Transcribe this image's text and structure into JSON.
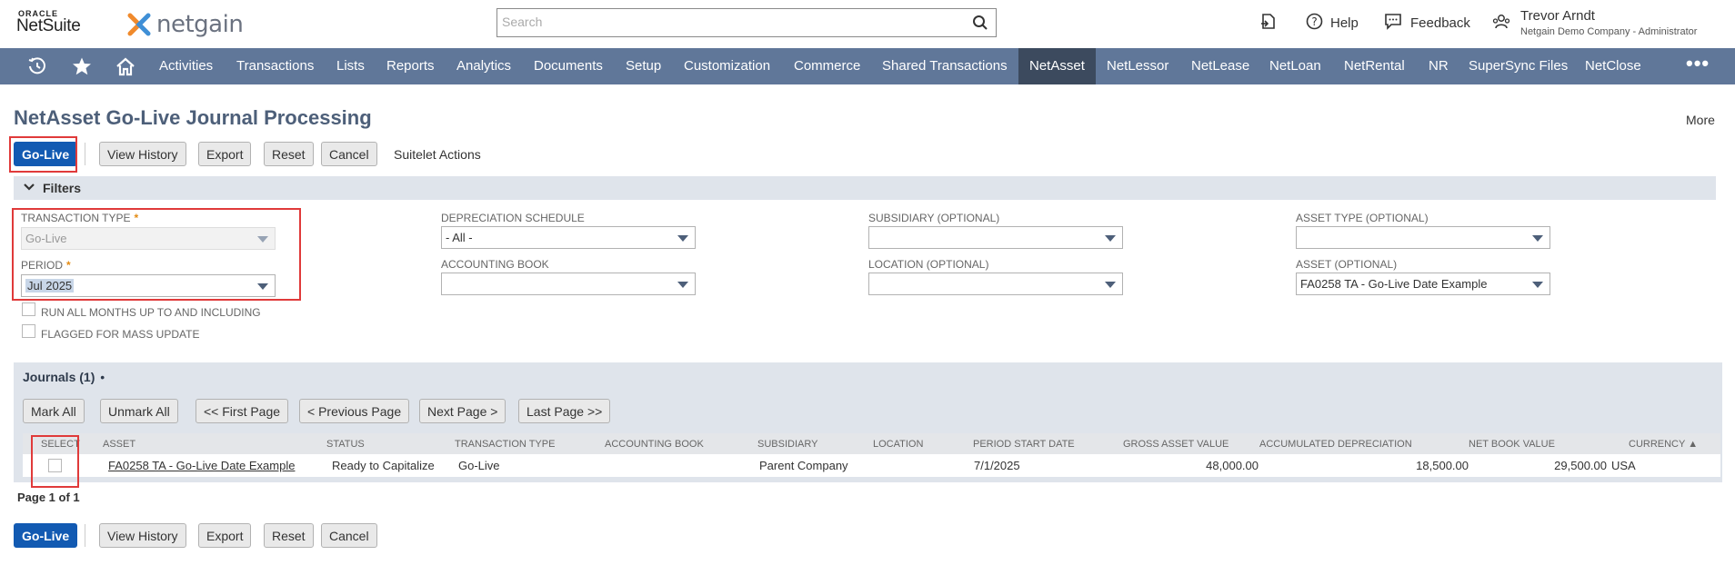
{
  "header": {
    "oracle_label": "ORACLE",
    "netsuite_label": "NetSuite",
    "netgain_label": "netgain",
    "search_placeholder": "Search",
    "help_label": "Help",
    "feedback_label": "Feedback",
    "user_name": "Trevor Arndt",
    "user_role": "Netgain Demo Company - Administrator"
  },
  "nav": {
    "items": [
      "Activities",
      "Transactions",
      "Lists",
      "Reports",
      "Analytics",
      "Documents",
      "Setup",
      "Customization",
      "Commerce",
      "Shared Transactions",
      "NetAsset",
      "NetLessor",
      "NetLease",
      "NetLoan",
      "NetRental",
      "NR",
      "SuperSync Files",
      "NetClose"
    ],
    "active": "NetAsset",
    "more": "•••"
  },
  "page": {
    "title": "NetAsset Go-Live Journal Processing",
    "more_label": "More"
  },
  "actions": {
    "go_live": "Go-Live",
    "view_history": "View History",
    "export": "Export",
    "reset": "Reset",
    "cancel": "Cancel",
    "suitelet_actions": "Suitelet Actions"
  },
  "filters": {
    "section_label": "Filters",
    "transaction_type": {
      "label": "TRANSACTION TYPE",
      "value": "Go-Live"
    },
    "period": {
      "label": "PERIOD",
      "value": "Jul 2025"
    },
    "run_all_months": "RUN ALL MONTHS UP TO AND INCLUDING",
    "flagged_mass_update": "FLAGGED FOR MASS UPDATE",
    "depreciation_schedule": {
      "label": "DEPRECIATION SCHEDULE",
      "value": "- All -"
    },
    "accounting_book": {
      "label": "ACCOUNTING BOOK",
      "value": ""
    },
    "subsidiary": {
      "label": "SUBSIDIARY (OPTIONAL)",
      "value": ""
    },
    "location": {
      "label": "LOCATION (OPTIONAL)",
      "value": ""
    },
    "asset_type": {
      "label": "ASSET TYPE (OPTIONAL)",
      "value": ""
    },
    "asset": {
      "label": "ASSET (OPTIONAL)",
      "value": "FA0258 TA - Go-Live Date Example"
    }
  },
  "journals": {
    "tab_label": "Journals (1)",
    "tab_dot": "•",
    "buttons": {
      "mark_all": "Mark All",
      "unmark_all": "Unmark All",
      "first_page": "<< First Page",
      "previous_page": "< Previous Page",
      "next_page": "Next Page >",
      "last_page": "Last Page >>"
    },
    "columns": {
      "select": "SELECT",
      "asset": "ASSET",
      "status": "STATUS",
      "transaction_type": "TRANSACTION TYPE",
      "accounting_book": "ACCOUNTING BOOK",
      "subsidiary": "SUBSIDIARY",
      "location": "LOCATION",
      "period_start_date": "PERIOD START DATE",
      "gross_asset_value": "GROSS ASSET VALUE",
      "accumulated_depreciation": "ACCUMULATED DEPRECIATION",
      "net_book_value": "NET BOOK VALUE",
      "currency": "CURRENCY ▲"
    },
    "rows": [
      {
        "asset": "FA0258 TA - Go-Live Date Example",
        "status": "Ready to Capitalize",
        "transaction_type": "Go-Live",
        "accounting_book": "",
        "subsidiary": "Parent Company",
        "location": "",
        "period_start_date": "7/1/2025",
        "gross_asset_value": "48,000.00",
        "accumulated_depreciation": "18,500.00",
        "net_book_value": "29,500.00",
        "currency": "USA"
      }
    ],
    "page_count": "Page 1 of 1"
  },
  "colors": {
    "nav_bg": "#607799",
    "nav_active": "#3c4a5e",
    "primary_button": "#125ab2",
    "highlight": "#e03a3a",
    "title": "#4d5f79",
    "section_bg": "#dfe4eb"
  }
}
